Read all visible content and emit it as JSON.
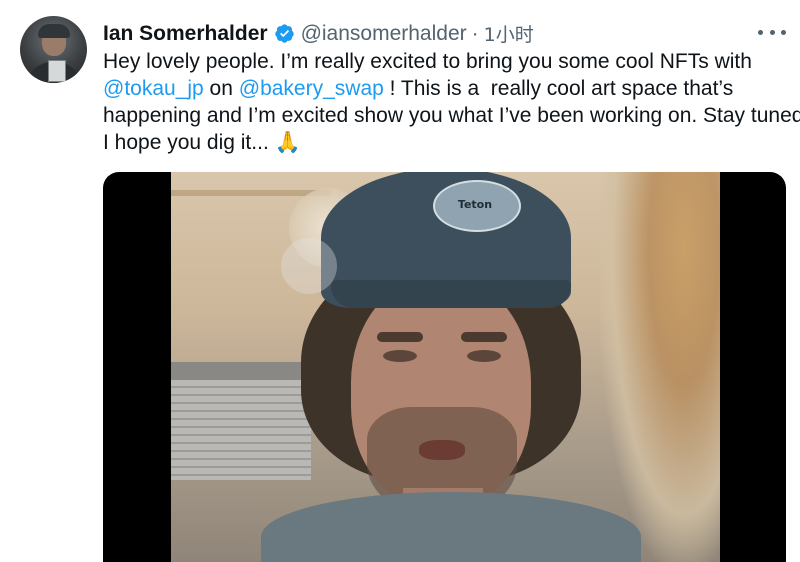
{
  "tweet": {
    "author_name": "Ian Somerhalder",
    "handle": "@iansomerhalder",
    "separator": "·",
    "time": "1小时",
    "text": {
      "line1": "Hey lovely people. I’m really excited to bring you some cool NFTs with",
      "mention1": "@tokau_jp",
      "on": " on ",
      "mention2": "@bakery_swap",
      "line2_rest": " ! This is a  really cool art space that’s",
      "line3": "happening and I’m excited show you what I’ve been working on. Stay tuned!",
      "line4": "I hope you dig it... 🙏"
    },
    "video": {
      "cap_patch_text": "Teton"
    }
  },
  "icons": {
    "verified": "verified-badge-icon",
    "more": "more-options-icon"
  },
  "colors": {
    "link": "#1d9bf0",
    "secondary_text": "#536471",
    "primary_text": "#0f1419",
    "verified": "#1d9bf0"
  }
}
